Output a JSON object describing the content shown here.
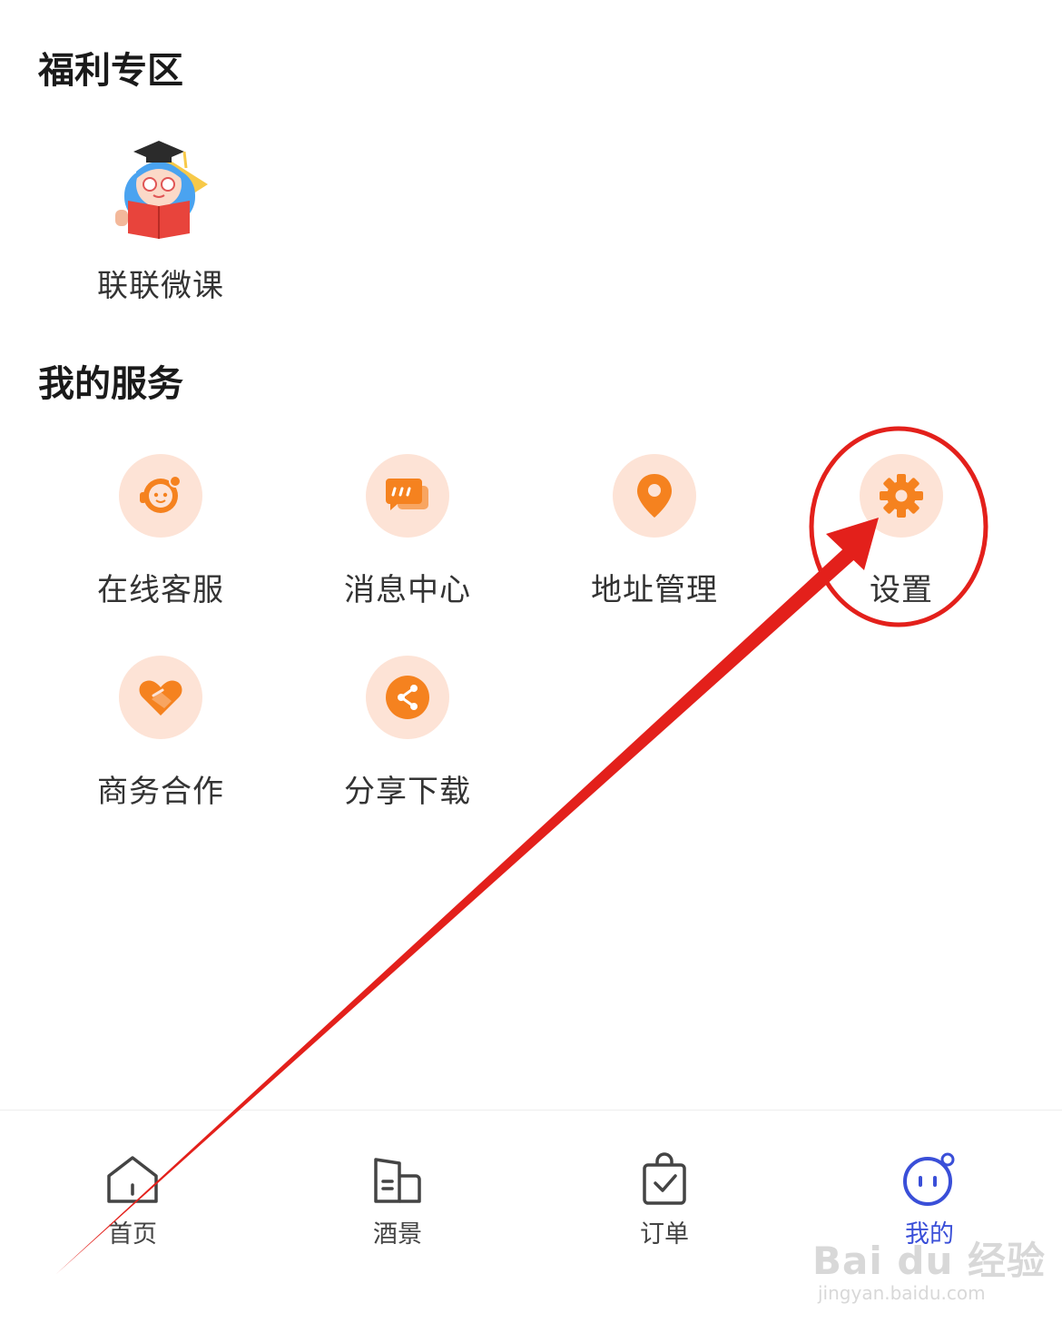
{
  "welfare": {
    "title": "福利专区",
    "items": [
      {
        "label": "联联微课",
        "icon": "graduate-reading-character-icon"
      }
    ]
  },
  "services": {
    "title": "我的服务",
    "items": [
      {
        "label": "在线客服",
        "icon": "customer-service-icon"
      },
      {
        "label": "消息中心",
        "icon": "message-bubble-icon"
      },
      {
        "label": "地址管理",
        "icon": "location-pin-icon"
      },
      {
        "label": "设置",
        "icon": "gear-icon"
      },
      {
        "label": "商务合作",
        "icon": "handshake-heart-icon"
      },
      {
        "label": "分享下载",
        "icon": "share-icon"
      }
    ]
  },
  "bottom_nav": {
    "items": [
      {
        "label": "首页",
        "icon": "home-icon"
      },
      {
        "label": "酒景",
        "icon": "hotel-building-icon"
      },
      {
        "label": "订单",
        "icon": "order-bag-icon"
      },
      {
        "label": "我的",
        "icon": "profile-face-icon",
        "active": true
      }
    ]
  },
  "watermark": {
    "brand": "Bai du 经验",
    "url": "jingyan.baidu.com"
  },
  "colors": {
    "accent": "#f5821f",
    "icon_bg": "#fde3d6",
    "nav_active": "#3a4fd8",
    "annotation": "#e3201b"
  }
}
